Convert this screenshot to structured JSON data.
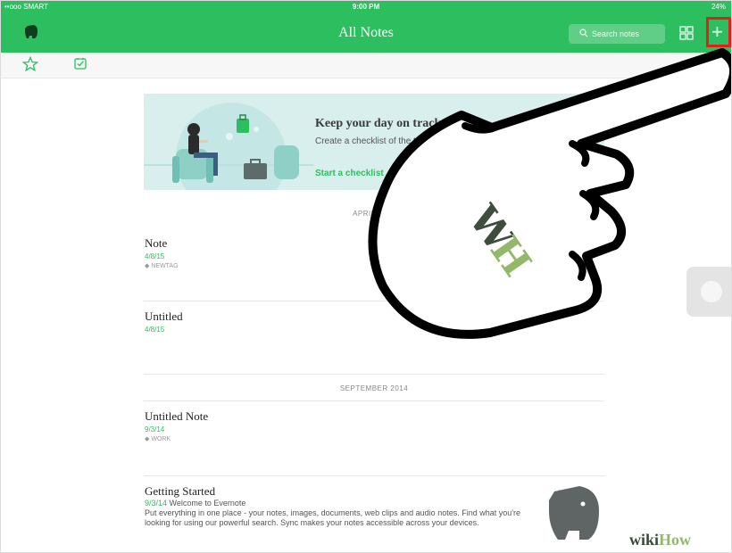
{
  "status_bar": {
    "carrier": "••ooo SMART",
    "time": "9:00 PM",
    "battery": "24%"
  },
  "nav": {
    "title": "All Notes",
    "search_placeholder": "Search notes",
    "add_label": "+",
    "accent": "#2dbe60",
    "highlight": "#e0201b"
  },
  "toolbar": {
    "right_text": ""
  },
  "banner": {
    "title": "Keep your day on track",
    "text": "Create a checklist of the things you need to do today.",
    "link": "Start a checklist"
  },
  "sections": [
    {
      "header": "APRIL 2015",
      "notes": [
        {
          "title": "Note",
          "date": "4/8/15",
          "tag": "NEWTAG"
        },
        {
          "title": "Untitled",
          "date": "4/8/15"
        }
      ]
    },
    {
      "header": "SEPTEMBER 2014",
      "notes": [
        {
          "title": "Untitled Note",
          "date": "9/3/14",
          "tag": "WORK"
        },
        {
          "title": "Getting Started",
          "date": "9/3/14",
          "snippet": "Welcome to Evernote",
          "body": "Put everything in one place - your notes, images, documents, web clips and audio notes. Find what you're looking for using our powerful search. Sync makes your notes accessible across your devices."
        }
      ]
    }
  ],
  "watermark": {
    "left": "wiki",
    "right": "How"
  },
  "icons": {
    "logo": "evernote-elephant-icon",
    "search": "search-icon",
    "grid": "grid-view-icon",
    "star": "star-icon",
    "checklist": "checklist-icon",
    "tag": "tag-icon"
  }
}
